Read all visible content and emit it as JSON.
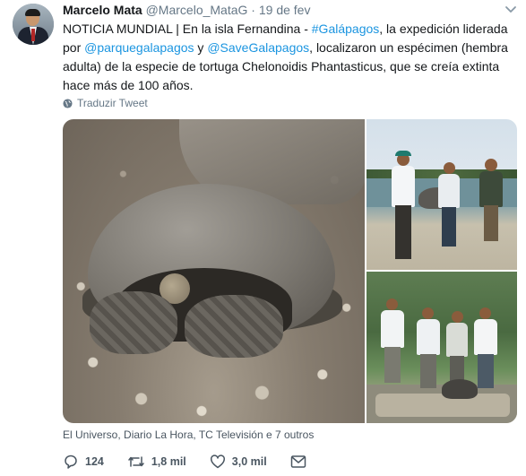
{
  "tweet": {
    "author_name": "Marcelo Mata",
    "author_handle": "@Marcelo_MataG",
    "separator": "·",
    "date": "19 de fev",
    "text_parts": {
      "p1": "NOTICIA MUNDIAL | En la isla Fernandina - ",
      "hashtag": "#Galápagos",
      "p2": ", la expedición liderada por ",
      "mention1": "@parquegalapagos",
      "p3": " y ",
      "mention2": "@SaveGalapagos",
      "p4": ", localizaron un espécimen (hembra adulta) de la especie de tortuga Chelonoidis Phantasticus, que se creía extinta hace más de 100 años."
    },
    "translate_label": "Traduzir Tweet",
    "media_sources": "El Universo, Diario La Hora, TC Televisión e 7 outros"
  },
  "actions": {
    "reply_count": "124",
    "retweet_count": "1,8 mil",
    "like_count": "3,0 mil"
  },
  "icons": {
    "reply": "reply-icon",
    "retweet": "retweet-icon",
    "like": "heart-icon",
    "message": "envelope-icon",
    "translate": "globe-icon",
    "menu": "chevron-down-icon"
  },
  "colors": {
    "link": "#1b95e0",
    "secondary_text": "#657786",
    "primary_text": "#14171a"
  }
}
